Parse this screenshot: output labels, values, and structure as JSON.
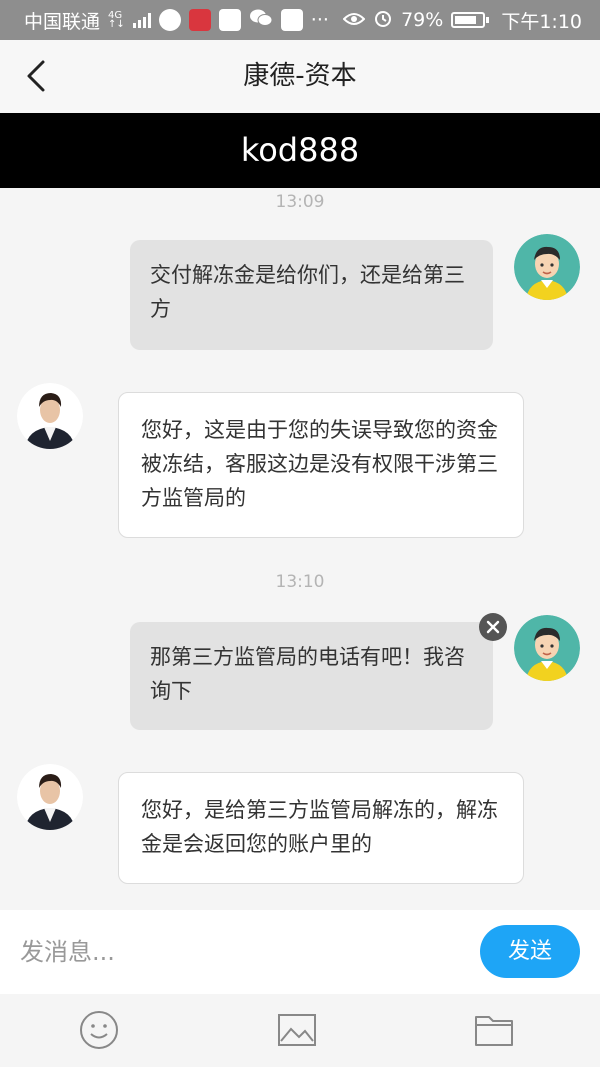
{
  "status_bar": {
    "carrier": "中国联通",
    "network": "4G",
    "battery": "79%",
    "time": "下午1:10",
    "icons": [
      "signal-icon",
      "app-icon",
      "app-icon",
      "wechat-icon",
      "video-app-icon",
      "more-icon",
      "eye-icon",
      "alarm-icon",
      "battery-icon"
    ]
  },
  "header": {
    "title": "康德-资本",
    "banner": "kod888"
  },
  "messages": [
    {
      "type": "timestamp",
      "text": "13:09"
    },
    {
      "type": "sent",
      "text": "交付解冻金是给你们，还是给第三方"
    },
    {
      "type": "received",
      "text": "您好，这是由于您的失误导致您的资金被冻结，客服这边是没有权限干涉第三方监管局的"
    },
    {
      "type": "timestamp",
      "text": "13:10"
    },
    {
      "type": "sent",
      "text": "那第三方监管局的电话有吧！我咨询下"
    },
    {
      "type": "received",
      "text": "您好，是给第三方监管局解冻的，解冻金是会返回您的账户里的"
    }
  ],
  "input": {
    "placeholder": "发消息...",
    "send_label": "发送"
  },
  "toolbar": [
    "emoji-icon",
    "image-icon",
    "folder-icon"
  ],
  "colors": {
    "accent": "#1ea5f6",
    "banner": "#000000"
  }
}
